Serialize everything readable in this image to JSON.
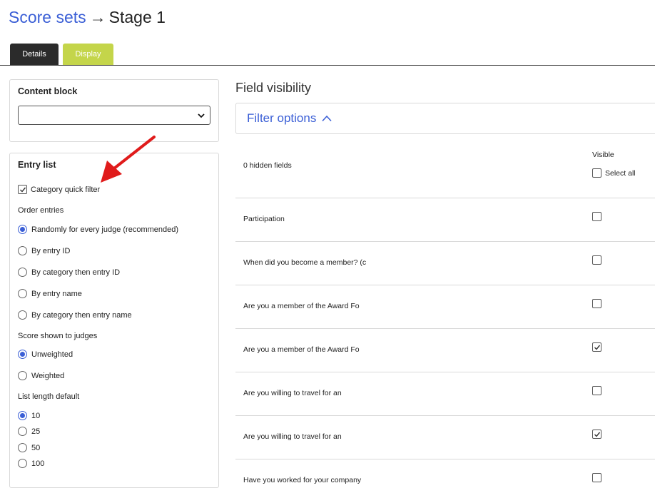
{
  "header": {
    "breadcrumb_link": "Score sets",
    "arrow": "→",
    "current": "Stage 1"
  },
  "tabs": [
    {
      "label": "Details",
      "active": true
    },
    {
      "label": "Display",
      "active": false
    }
  ],
  "content_block": {
    "heading": "Content block",
    "select_value": ""
  },
  "entry_list": {
    "heading": "Entry list",
    "category_quick_filter": {
      "label": "Category quick filter",
      "checked": true
    },
    "order_entries": {
      "label": "Order entries",
      "options": [
        {
          "label": "Randomly for every judge (recommended)",
          "selected": true
        },
        {
          "label": "By entry ID",
          "selected": false
        },
        {
          "label": "By category then entry ID",
          "selected": false
        },
        {
          "label": "By entry name",
          "selected": false
        },
        {
          "label": "By category then entry name",
          "selected": false
        }
      ]
    },
    "score_shown": {
      "label": "Score shown to judges",
      "options": [
        {
          "label": "Unweighted",
          "selected": true
        },
        {
          "label": "Weighted",
          "selected": false
        }
      ]
    },
    "list_length": {
      "label": "List length default",
      "options": [
        {
          "label": "10",
          "selected": true
        },
        {
          "label": "25",
          "selected": false
        },
        {
          "label": "50",
          "selected": false
        },
        {
          "label": "100",
          "selected": false
        }
      ]
    }
  },
  "field_visibility": {
    "title": "Field visibility",
    "filter_options_label": "Filter options",
    "hidden_count": "0 hidden fields",
    "visible_header": "Visible",
    "select_all_label": "Select all",
    "fields": [
      {
        "label": "Participation",
        "visible": false
      },
      {
        "label": "When did you become a member? (c",
        "visible": false
      },
      {
        "label": "Are you a member of the Award Fo",
        "visible": false
      },
      {
        "label": "Are you a member of the Award Fo",
        "visible": true
      },
      {
        "label": "Are you willing to travel for an",
        "visible": false
      },
      {
        "label": "Are you willing to travel for an",
        "visible": true
      },
      {
        "label": "Have you worked for your company",
        "visible": false
      }
    ]
  },
  "colors": {
    "accent_blue": "#3b5fd6",
    "tab_dark": "#2b2b2b",
    "tab_green": "#c4d54a",
    "annotation_red": "#e01b1b"
  }
}
